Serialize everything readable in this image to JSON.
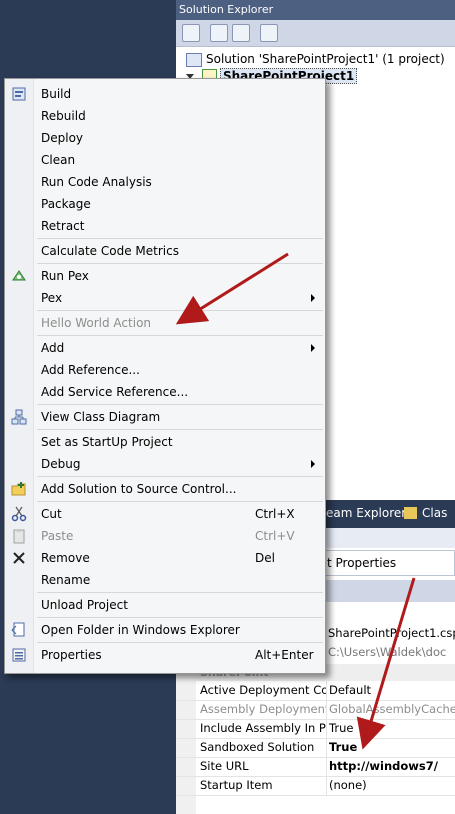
{
  "solution_explorer": {
    "title": "Solution Explorer",
    "solution_label": "Solution 'SharePointProject1' (1 project)",
    "project_label": "SharePointProject1"
  },
  "tabs": {
    "team_explorer": "eam Explorer",
    "class_view": "Clas"
  },
  "properties": {
    "header_text": "t Properties",
    "file_row": "SharePointProject1.csp",
    "path_row": "C:\\Users\\Waldek\\doc",
    "category": "SharePoint",
    "rows": [
      {
        "name": "Active Deployment Cor",
        "value": "Default",
        "bold": false,
        "gray": false
      },
      {
        "name": "Assembly Deployment",
        "value": "GlobalAssemblyCache",
        "bold": false,
        "gray": true
      },
      {
        "name": "Include Assembly In Pa",
        "value": "True",
        "bold": false,
        "gray": false
      },
      {
        "name": "Sandboxed Solution",
        "value": "True",
        "bold": true,
        "gray": false
      },
      {
        "name": "Site URL",
        "value": "http://windows7/",
        "bold": true,
        "gray": false
      },
      {
        "name": "Startup Item",
        "value": "(none)",
        "bold": false,
        "gray": false
      }
    ]
  },
  "menu": {
    "items": [
      {
        "label": "Build",
        "icon": "build-icon"
      },
      {
        "label": "Rebuild"
      },
      {
        "label": "Deploy"
      },
      {
        "label": "Clean"
      },
      {
        "label": "Run Code Analysis"
      },
      {
        "label": "Package"
      },
      {
        "label": "Retract"
      },
      {
        "label": "Calculate Code Metrics"
      },
      {
        "label": "Run Pex",
        "icon": "pex-icon"
      },
      {
        "label": "Pex"
      },
      {
        "label": "Hello World Action",
        "disabled": true
      },
      {
        "label": "Add"
      },
      {
        "label": "Add Reference..."
      },
      {
        "label": "Add Service Reference..."
      },
      {
        "label": "View Class Diagram",
        "icon": "class-diagram-icon"
      },
      {
        "label": "Set as StartUp Project"
      },
      {
        "label": "Debug"
      },
      {
        "label": "Add Solution to Source Control...",
        "icon": "folder-add-icon"
      },
      {
        "label": "Cut",
        "shortcut": "Ctrl+X",
        "icon": "scissors-icon"
      },
      {
        "label": "Paste",
        "shortcut": "Ctrl+V",
        "disabled": true,
        "icon": "paste-icon"
      },
      {
        "label": "Remove",
        "shortcut": "Del",
        "icon": "remove-x-icon"
      },
      {
        "label": "Rename"
      },
      {
        "label": "Unload Project"
      },
      {
        "label": "Open Folder in Windows Explorer",
        "icon": "open-folder-icon"
      },
      {
        "label": "Properties",
        "shortcut": "Alt+Enter",
        "icon": "properties-icon"
      }
    ]
  },
  "colors": {
    "annotation_arrow": "#b01a1a",
    "menu_background": "#f5f6f7",
    "vs_dark_background": "#2b3a55"
  }
}
